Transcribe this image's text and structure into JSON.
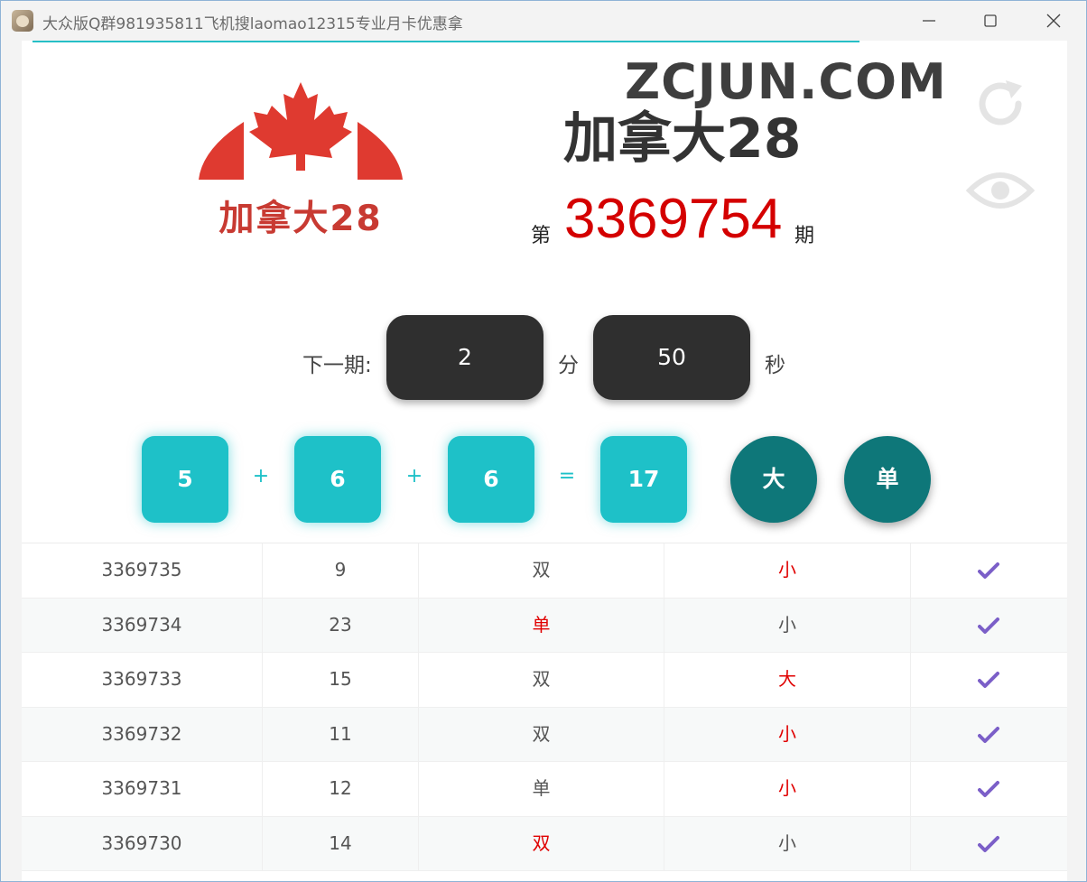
{
  "window": {
    "title": "大众版Q群981935811飞机搜laomao12315专业月卡优惠拿"
  },
  "header": {
    "logo_text": "加拿大28",
    "watermark": "ZCJUN.COM",
    "game_title": "加拿大28",
    "period_prefix": "第",
    "period_number": "3369754",
    "period_suffix": "期"
  },
  "countdown": {
    "label": "下一期:",
    "minutes": "2",
    "minutes_unit": "分",
    "seconds": "50",
    "seconds_unit": "秒"
  },
  "result": {
    "balls": [
      "5",
      "6",
      "6"
    ],
    "plus": "+",
    "equals": "=",
    "sum": "17",
    "size_tag": "大",
    "parity_tag": "单"
  },
  "history": [
    {
      "period": "3369735",
      "sum": "9",
      "parity": "双",
      "size": "小",
      "parity_red": false,
      "size_red": true
    },
    {
      "period": "3369734",
      "sum": "23",
      "parity": "单",
      "size": "小",
      "parity_red": true,
      "size_red": false
    },
    {
      "period": "3369733",
      "sum": "15",
      "parity": "双",
      "size": "大",
      "parity_red": false,
      "size_red": true
    },
    {
      "period": "3369732",
      "sum": "11",
      "parity": "双",
      "size": "小",
      "parity_red": false,
      "size_red": true
    },
    {
      "period": "3369731",
      "sum": "12",
      "parity": "单",
      "size": "小",
      "parity_red": false,
      "size_red": true
    },
    {
      "period": "3369730",
      "sum": "14",
      "parity": "双",
      "size": "小",
      "parity_red": true,
      "size_red": false
    }
  ],
  "colors": {
    "accent": "#1ec1c8",
    "tag": "#0e7779",
    "period_red": "#d40000",
    "check": "#7b5fc8"
  },
  "icons": {
    "refresh": "refresh-icon",
    "eye": "eye-icon",
    "check": "check-icon",
    "maple_leaf": "maple-leaf-icon"
  }
}
